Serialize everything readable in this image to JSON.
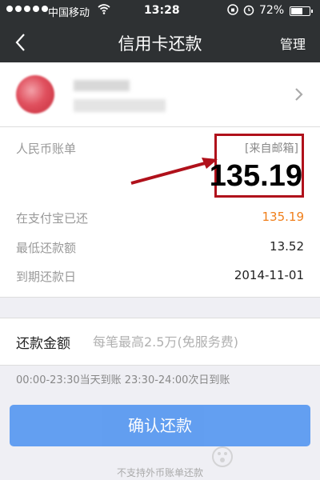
{
  "status_bar": {
    "carrier": "中国移动",
    "time": "13:28",
    "battery": "72%",
    "battery_level": 0.72
  },
  "nav": {
    "title": "信用卡还款",
    "right_action": "管理"
  },
  "bill": {
    "currency_label": "人民币账单",
    "source": "[来自邮箱]",
    "total": "135.19",
    "rows": [
      {
        "label": "在支付宝已还",
        "value": "135.19",
        "color": "#f07f1b"
      },
      {
        "label": "最低还款额",
        "value": "13.52"
      },
      {
        "label": "到期还款日",
        "value": "2014-11-01"
      }
    ]
  },
  "repay": {
    "label": "还款金额",
    "placeholder": "每笔最高2.5万(免服务费)"
  },
  "hint": "00:00-23:30当天到账  23:30-24:00次日到账",
  "confirm_label": "确认还款",
  "footer_note": "不支持外币账单还款",
  "colors": {
    "header_bg": "#2e3133",
    "accent_blue": "#4a90f0",
    "orange": "#f07f1b",
    "highlight_red": "#b0111b"
  }
}
